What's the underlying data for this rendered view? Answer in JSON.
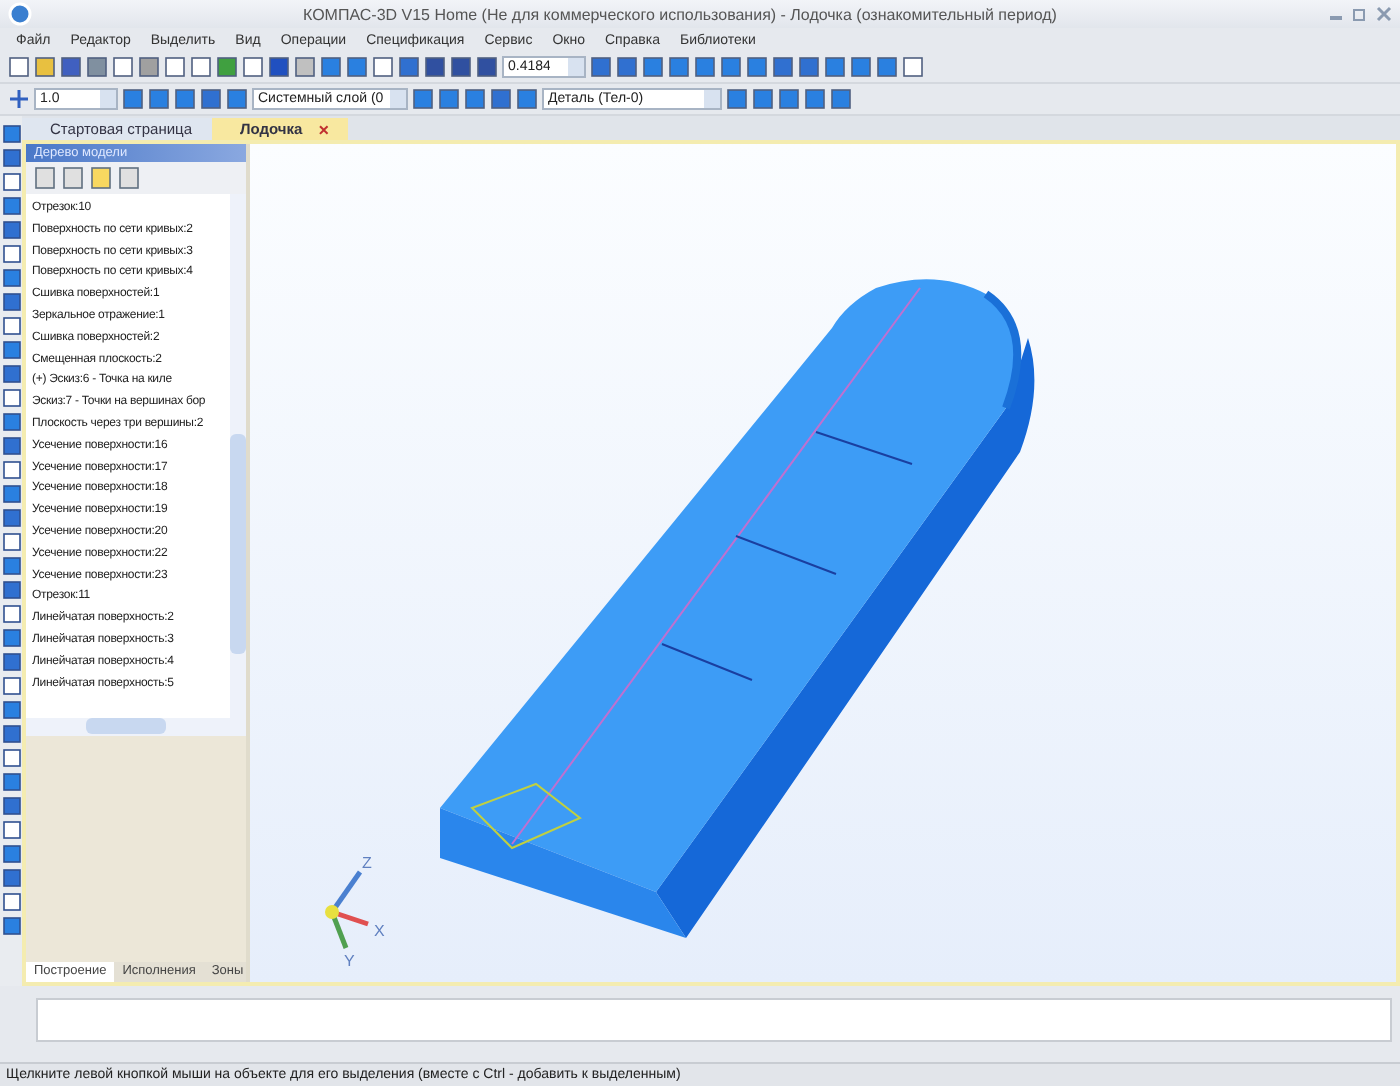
{
  "window": {
    "title": "КОМПАС-3D V15 Home (Не для коммерческого использования) - Лодочка (ознакомительный период)"
  },
  "menu": [
    "Файл",
    "Редактор",
    "Выделить",
    "Вид",
    "Операции",
    "Спецификация",
    "Сервис",
    "Окно",
    "Справка",
    "Библиотеки"
  ],
  "toolbar": {
    "scale": "0.4184",
    "step": "1.0",
    "layer": "Системный слой (0",
    "part": "Деталь (Тел-0)"
  },
  "doc_tabs": [
    {
      "label": "Стартовая страница",
      "selected": false
    },
    {
      "label": "Лодочка",
      "selected": true,
      "close": "×"
    }
  ],
  "tree_panel": {
    "title": "Дерево модели",
    "items": [
      "Отрезок:10",
      "Поверхность по сети кривых:2",
      "Поверхность по сети кривых:3",
      "Поверхность по сети кривых:4",
      "Сшивка поверхностей:1",
      "Зеркальное отражение:1",
      "Сшивка поверхностей:2",
      "Смещенная плоскость:2",
      "(+) Эскиз:6 - Точка на киле",
      "Эскиз:7 - Точки на вершинах бор",
      "Плоскость через три вершины:2",
      "Усечение поверхности:16",
      "Усечение поверхности:17",
      "Усечение поверхности:18",
      "Усечение поверхности:19",
      "Усечение поверхности:20",
      "Усечение поверхности:22",
      "Усечение поверхности:23",
      "Отрезок:11",
      "Линейчатая поверхность:2",
      "Линейчатая поверхность:3",
      "Линейчатая поверхность:4",
      "Линейчатая поверхность:5"
    ],
    "tabs": [
      {
        "label": "Построение",
        "selected": true
      },
      {
        "label": "Исполнения",
        "selected": false
      },
      {
        "label": "Зоны",
        "selected": false
      }
    ]
  },
  "axes": [
    "Z",
    "X",
    "Y"
  ],
  "status_bar": "Щелкните левой кнопкой мыши на объекте для его выделения (вместе с Ctrl - добавить к выделенным)"
}
